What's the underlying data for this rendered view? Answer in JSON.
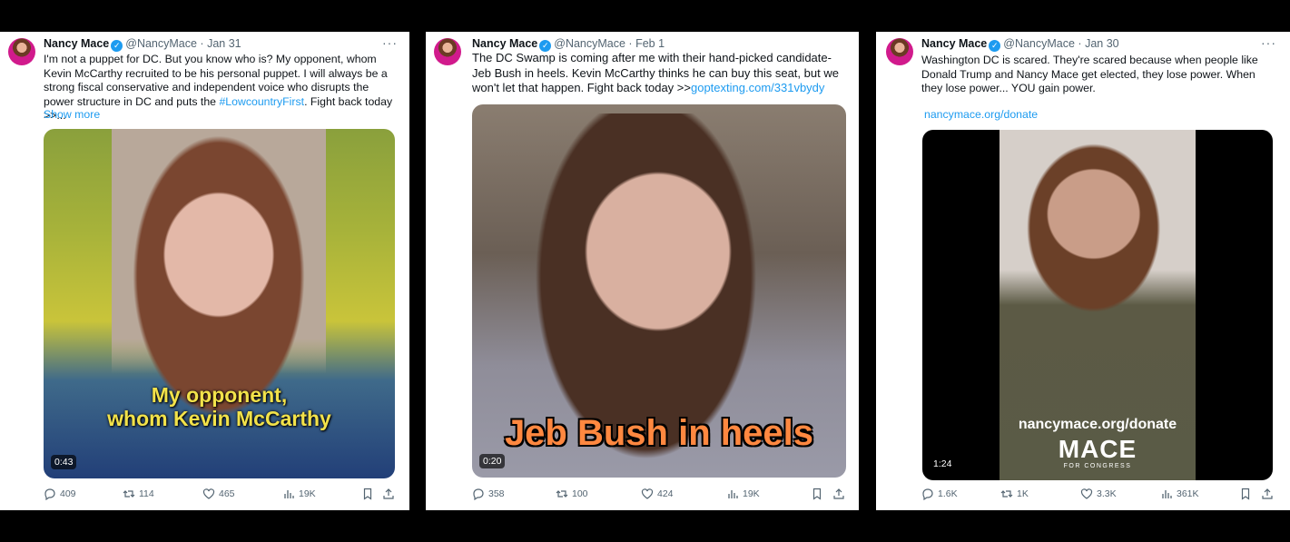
{
  "colors": {
    "link": "#1d9bf0",
    "verified": "#1d9bf0",
    "text": "#0f1419",
    "muted": "#536471"
  },
  "tweets": [
    {
      "name": "Nancy Mace",
      "handle": "@NancyMace",
      "date": "Jan 31",
      "text_parts": [
        "I'm not a puppet for DC. But you know who is? My opponent, whom Kevin McCarthy recruited to be his personal puppet. I will always be a strong fiscal conservative and independent voice who disrupts the power structure in DC and puts the ",
        "#LowcountryFirst",
        ". Fight back today >>..."
      ],
      "show_more": "Show more",
      "caption_line1": "My opponent,",
      "caption_line2": "whom Kevin McCarthy",
      "duration": "0:43",
      "replies": "409",
      "retweets": "114",
      "likes": "465",
      "views": "19K"
    },
    {
      "name": "Nancy Mace",
      "handle": "@NancyMace",
      "date": "Feb 1",
      "text_parts": [
        "The DC Swamp is coming after me with their hand-picked candidate- Jeb Bush in heels. Kevin McCarthy thinks he can buy this seat, but we won't let that happen. Fight back today >>",
        "goptexting.com/331vbydy"
      ],
      "caption": "Jeb Bush in heels",
      "duration": "0:20",
      "replies": "358",
      "retweets": "100",
      "likes": "424",
      "views": "19K"
    },
    {
      "name": "Nancy Mace",
      "handle": "@NancyMace",
      "date": "Jan 30",
      "text": "Washington DC is scared. They're scared because when people like Donald Trump and Nancy Mace get elected, they lose power. When they lose power... YOU gain power.",
      "link": "nancymace.org/donate",
      "caption": "nancymace.org/donate",
      "logo_big": "MACE",
      "logo_small": "FOR CONGRESS",
      "duration": "1:24",
      "replies": "1.6K",
      "retweets": "1K",
      "likes": "3.3K",
      "views": "361K"
    }
  ],
  "icons": [
    "more-icon",
    "verified-icon",
    "reply-icon",
    "retweet-icon",
    "like-icon",
    "views-icon",
    "bookmark-icon",
    "share-icon"
  ]
}
